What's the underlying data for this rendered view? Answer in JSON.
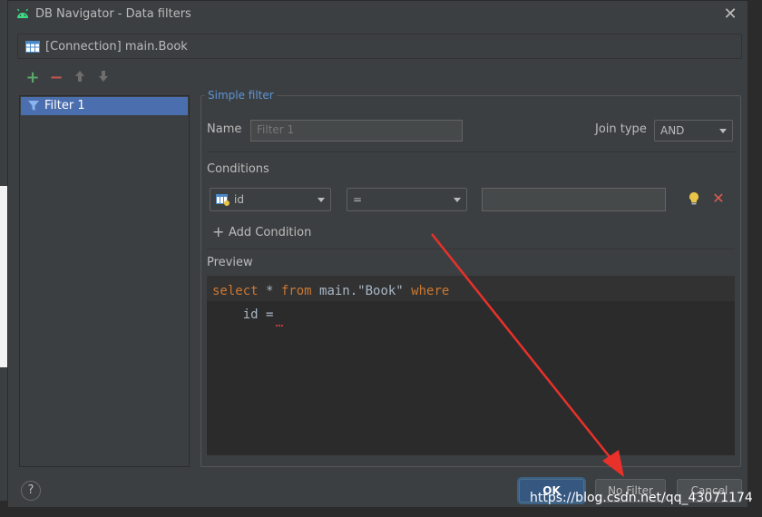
{
  "window": {
    "title": "DB Navigator - Data filters"
  },
  "connection": {
    "label": "[Connection] main.Book"
  },
  "toolbar": {
    "add": "+",
    "remove": "−"
  },
  "filters": {
    "items": [
      {
        "label": "Filter 1"
      }
    ]
  },
  "simple_filter": {
    "legend": "Simple filter",
    "name_label": "Name",
    "name_placeholder": "Filter 1",
    "join_type_label": "Join type",
    "join_type_value": "AND",
    "conditions_label": "Conditions",
    "condition": {
      "column": "id",
      "operator": "=",
      "value": ""
    },
    "add_condition_label": "Add Condition",
    "preview_label": "Preview",
    "preview": {
      "kw_select": "select",
      "star": " * ",
      "kw_from": "from",
      "table": " main.\"Book\" ",
      "kw_where": "where",
      "line2": "    id ="
    }
  },
  "buttons": {
    "help": "?",
    "ok": "OK",
    "no_filter": "No Filter",
    "cancel": "Cancel"
  },
  "watermark": "https://blog.csdn.net/qq_43071174",
  "colors": {
    "accent": "#4b6eaf",
    "keyword": "#cc7832",
    "legend": "#5c94d6",
    "annotation_arrow": "#e8312a"
  }
}
